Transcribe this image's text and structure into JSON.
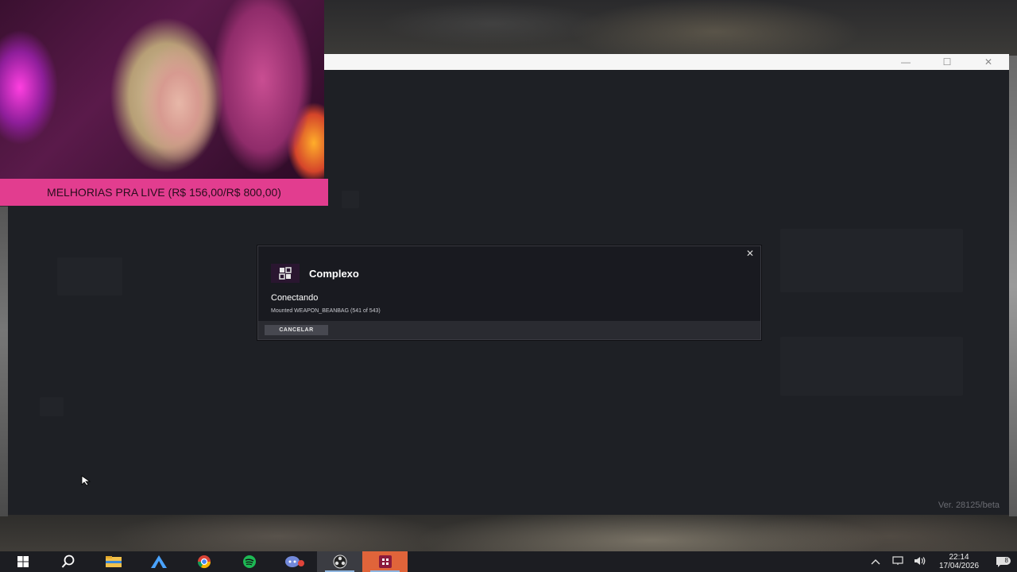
{
  "stream_overlay": {
    "banner_text": "MELHORIAS PRA LIVE (R$ 156,00/R$ 800,00)",
    "goal_progress": 0.195
  },
  "window": {
    "minimize_glyph": "—",
    "maximize_glyph": "☐",
    "close_glyph": "✕"
  },
  "modal": {
    "close_glyph": "✕",
    "server_name": "Complexo",
    "server_icon": "server-logo-icon",
    "status_title": "Conectando",
    "status_detail": "Mounted WEAPON_BEANBAG (541 of 543)",
    "cancel_label": "CANCELAR",
    "progress_current": 541,
    "progress_total": 543
  },
  "version_label": "Ver. 28125/beta",
  "taskbar": {
    "apps": [
      {
        "name": "start-icon"
      },
      {
        "name": "search-icon"
      },
      {
        "name": "file-explorer-icon"
      },
      {
        "name": "arduino-icon"
      },
      {
        "name": "chrome-icon"
      },
      {
        "name": "spotify-icon"
      },
      {
        "name": "discord-icon"
      },
      {
        "name": "obs-icon"
      },
      {
        "name": "fivem-icon"
      }
    ],
    "time": "22:14",
    "date": "17/04/2026",
    "notification_count": "8"
  },
  "colors": {
    "banner": "#e23d8f",
    "modal_bg": "#191a20",
    "cancel_bg": "#474850",
    "fivem_active": "#e0643a"
  }
}
